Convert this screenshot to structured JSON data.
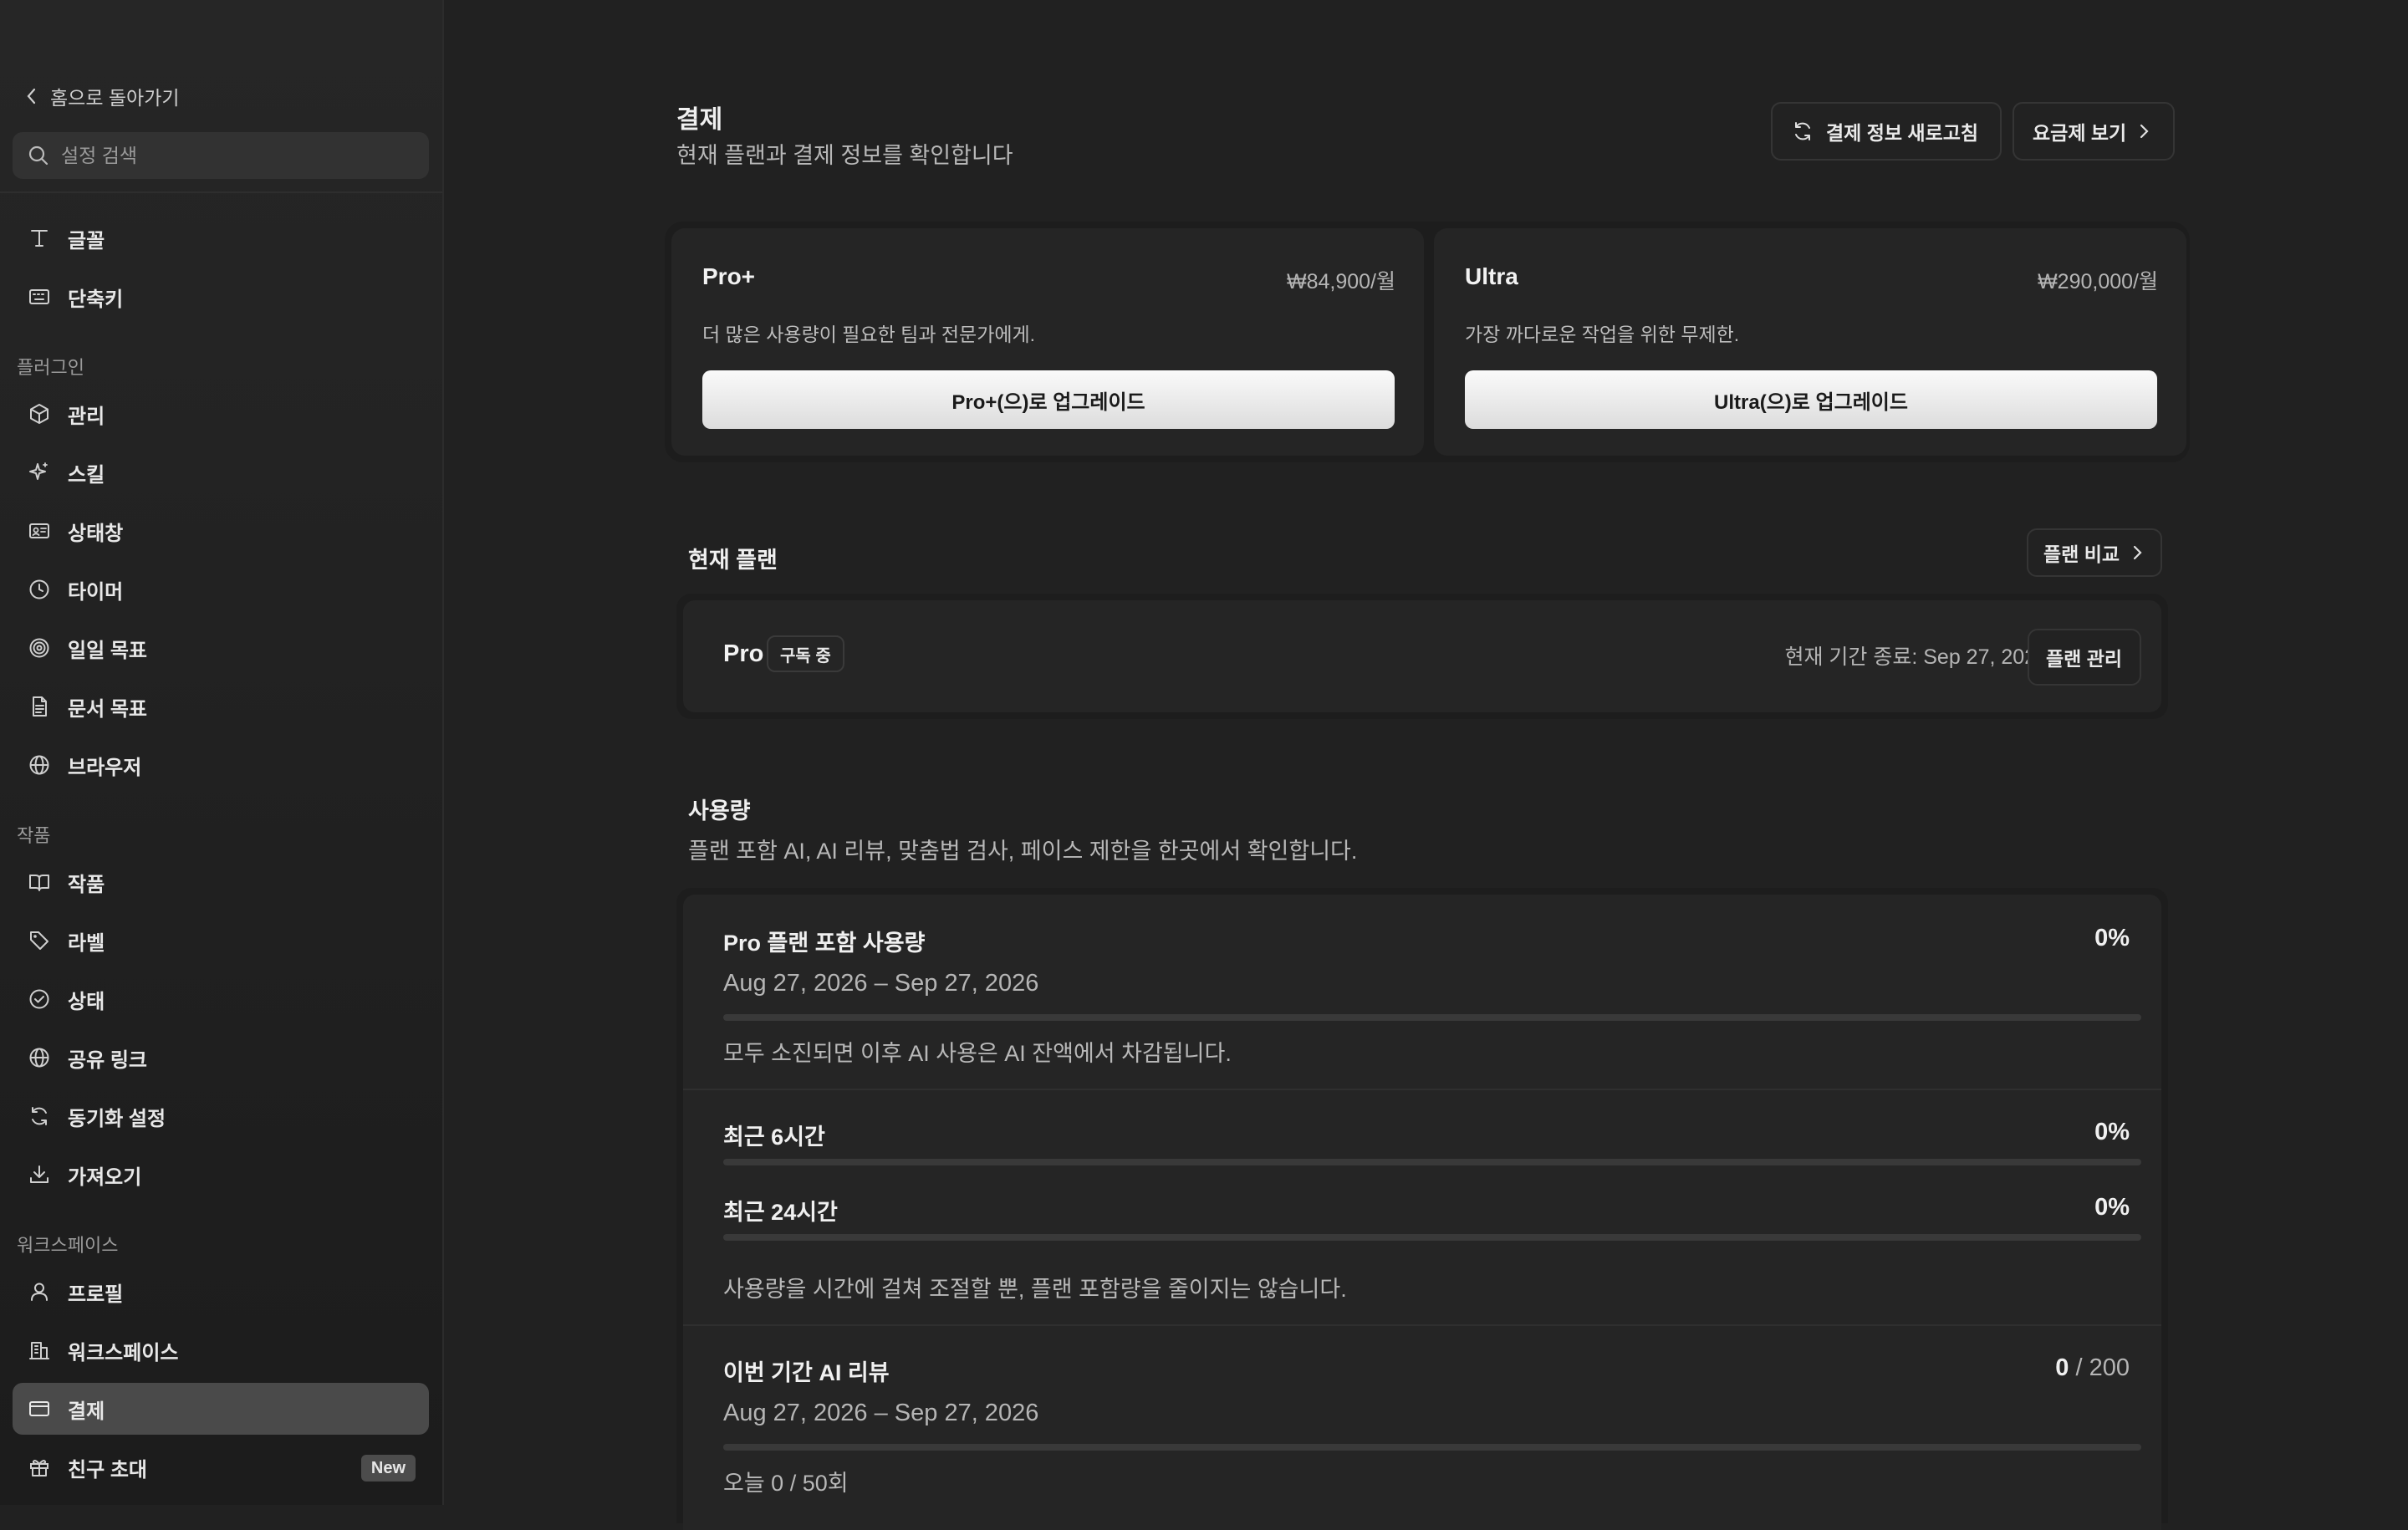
{
  "sidebar": {
    "back_label": "홈으로 돌아가기",
    "search_placeholder": "설정 검색",
    "items": {
      "font": "글꼴",
      "shortcuts": "단축키",
      "plugin_section": "플러그인",
      "manage": "관리",
      "skills": "스킬",
      "statusbar": "상태창",
      "timer": "타이머",
      "daily_goal": "일일 목표",
      "doc_goal": "문서 목표",
      "browser": "브라우저",
      "works_section": "작품",
      "works": "작품",
      "labels": "라벨",
      "status": "상태",
      "share_link": "공유 링크",
      "sync_settings": "동기화 설정",
      "import": "가져오기",
      "workspace_section": "워크스페이스",
      "profile": "프로필",
      "workspace": "워크스페이스",
      "billing": "결제",
      "invite": "친구 초대",
      "invite_badge": "New"
    }
  },
  "header": {
    "title": "결제",
    "subtitle": "현재 플랜과 결제 정보를 확인합니다",
    "refresh_label": "결제 정보 새로고침",
    "pricing_label": "요금제 보기"
  },
  "plans": [
    {
      "name": "Pro+",
      "price": "₩84,900/월",
      "desc": "더 많은 사용량이 필요한 팀과 전문가에게.",
      "button": "Pro+(으)로 업그레이드"
    },
    {
      "name": "Ultra",
      "price": "₩290,000/월",
      "desc": "가장 까다로운 작업을 위한 무제한.",
      "button": "Ultra(으)로 업그레이드"
    }
  ],
  "current_plan": {
    "section_title": "현재 플랜",
    "compare_label": "플랜 비교",
    "name": "Pro",
    "badge": "구독 중",
    "period_end": "현재 기간 종료: Sep 27, 2026",
    "manage_label": "플랜 관리"
  },
  "usage": {
    "title": "사용량",
    "subtitle": "플랜 포함 AI, AI 리뷰, 맞춤법 검사, 페이스 제한을 한곳에서 확인합니다.",
    "included": {
      "title": "Pro 플랜 포함 사용량",
      "pct": "0%",
      "progress": 0,
      "period": "Aug 27, 2026 – Sep 27, 2026",
      "note": "모두 소진되면 이후 AI 사용은 AI 잔액에서 차감됩니다."
    },
    "last6h": {
      "title": "최근 6시간",
      "pct": "0%",
      "progress": 0
    },
    "last24h": {
      "title": "최근 24시간",
      "pct": "0%",
      "progress": 0
    },
    "pace_note": "사용량을 시간에 걸쳐 조절할 뿐, 플랜 포함량을 줄이지는 않습니다.",
    "ai_review": {
      "title": "이번 기간 AI 리뷰",
      "used": "0",
      "limit": " / 200",
      "progress": 0,
      "period": "Aug 27, 2026 – Sep 27, 2026",
      "today": "오늘 0 / 50회"
    }
  },
  "colors": {
    "background": "#212121",
    "sidebar": "#222222",
    "active_item": "#4a4a4a",
    "card": "#252525"
  }
}
